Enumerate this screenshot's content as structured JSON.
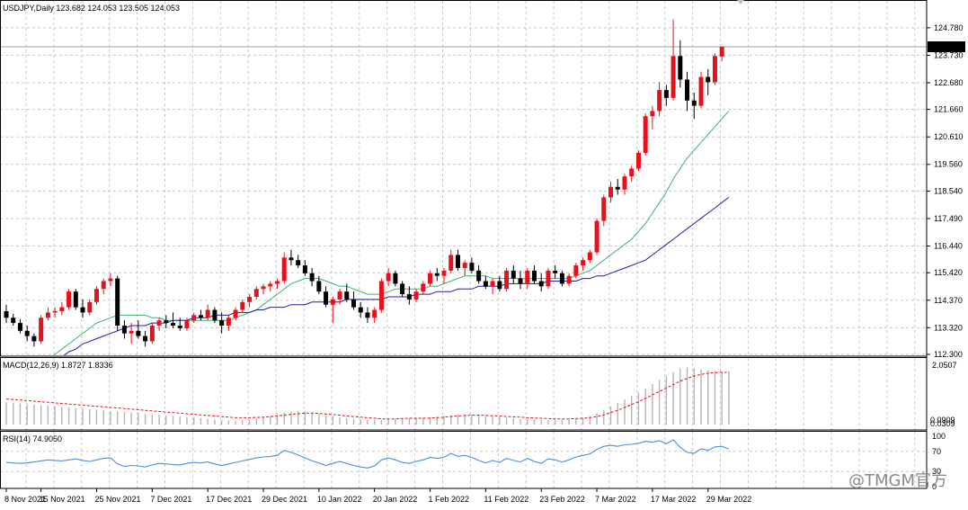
{
  "chart_data": [
    {
      "type": "candlestick",
      "header": "USDJPY,Daily  123.682 124.053 123.505 124.053",
      "price_axis": {
        "min": 112.3,
        "max": 125.05,
        "ticks": [
          "124.780",
          "123.730",
          "122.680",
          "121.660",
          "120.610",
          "119.560",
          "118.540",
          "117.490",
          "116.440",
          "115.420",
          "114.370",
          "113.320",
          "112.300"
        ]
      },
      "current_price": "124.053",
      "x_labels": [
        "8 Nov 2021",
        "15 Nov 2021",
        "25 Nov 2021",
        "7 Dec 2021",
        "17 Dec 2021",
        "29 Dec 2021",
        "10 Jan 2022",
        "20 Jan 2022",
        "1 Feb 2022",
        "11 Feb 2022",
        "23 Feb 2022",
        "7 Mar 2022",
        "17 Mar 2022",
        "29 Mar 2022"
      ],
      "x_label_index": [
        0,
        5,
        13,
        21,
        29,
        37,
        45,
        53,
        61,
        69,
        77,
        85,
        93,
        101
      ],
      "candles": [
        [
          113.95,
          114.2,
          113.5,
          113.7
        ],
        [
          113.7,
          113.85,
          113.4,
          113.5
        ],
        [
          113.5,
          113.65,
          113.1,
          113.2
        ],
        [
          113.2,
          113.4,
          112.8,
          113.0
        ],
        [
          113.0,
          113.1,
          112.6,
          112.8
        ],
        [
          112.8,
          113.8,
          112.7,
          113.7
        ],
        [
          113.7,
          114.1,
          113.6,
          113.9
        ],
        [
          113.9,
          114.1,
          113.7,
          113.95
        ],
        [
          113.95,
          114.3,
          113.8,
          114.1
        ],
        [
          114.1,
          114.8,
          114.0,
          114.7
        ],
        [
          114.7,
          114.8,
          114.0,
          114.1
        ],
        [
          114.1,
          114.4,
          113.7,
          113.9
        ],
        [
          113.9,
          114.4,
          113.8,
          114.3
        ],
        [
          114.3,
          114.9,
          114.2,
          114.8
        ],
        [
          114.8,
          115.2,
          114.6,
          115.1
        ],
        [
          115.1,
          115.4,
          114.9,
          115.2
        ],
        [
          115.2,
          115.3,
          113.2,
          113.4
        ],
        [
          113.4,
          113.6,
          112.9,
          113.1
        ],
        [
          113.1,
          113.5,
          112.7,
          113.2
        ],
        [
          113.2,
          113.6,
          112.9,
          113.0
        ],
        [
          113.0,
          113.2,
          112.6,
          112.8
        ],
        [
          112.8,
          113.5,
          112.7,
          113.4
        ],
        [
          113.4,
          113.7,
          113.2,
          113.6
        ],
        [
          113.6,
          113.8,
          113.3,
          113.5
        ],
        [
          113.5,
          113.9,
          113.3,
          113.4
        ],
        [
          113.4,
          113.7,
          113.2,
          113.3
        ],
        [
          113.3,
          113.7,
          113.2,
          113.6
        ],
        [
          113.6,
          113.9,
          113.5,
          113.8
        ],
        [
          113.8,
          114.0,
          113.6,
          113.7
        ],
        [
          113.7,
          114.2,
          113.6,
          114.0
        ],
        [
          114.0,
          114.1,
          113.5,
          113.6
        ],
        [
          113.6,
          113.9,
          113.1,
          113.4
        ],
        [
          113.4,
          113.8,
          113.2,
          113.7
        ],
        [
          113.7,
          114.1,
          113.6,
          114.0
        ],
        [
          114.0,
          114.4,
          113.9,
          114.3
        ],
        [
          114.3,
          114.6,
          114.1,
          114.5
        ],
        [
          114.5,
          114.9,
          114.4,
          114.8
        ],
        [
          114.8,
          115.0,
          114.6,
          114.9
        ],
        [
          114.9,
          115.1,
          114.7,
          115.0
        ],
        [
          115.0,
          115.2,
          114.8,
          115.1
        ],
        [
          115.1,
          116.2,
          115.0,
          116.0
        ],
        [
          116.0,
          116.3,
          115.7,
          115.9
        ],
        [
          115.9,
          116.1,
          115.6,
          115.7
        ],
        [
          115.7,
          115.9,
          115.3,
          115.4
        ],
        [
          115.4,
          115.6,
          114.9,
          115.1
        ],
        [
          115.1,
          115.3,
          114.6,
          114.7
        ],
        [
          114.7,
          114.9,
          114.1,
          114.2
        ],
        [
          114.2,
          114.5,
          113.5,
          114.4
        ],
        [
          114.4,
          114.8,
          114.2,
          114.7
        ],
        [
          114.7,
          115.0,
          114.3,
          114.4
        ],
        [
          114.4,
          114.7,
          114.0,
          114.1
        ],
        [
          114.1,
          114.3,
          113.7,
          113.9
        ],
        [
          113.9,
          114.1,
          113.5,
          113.7
        ],
        [
          113.7,
          114.1,
          113.5,
          114.0
        ],
        [
          114.0,
          115.2,
          113.9,
          115.1
        ],
        [
          115.1,
          115.6,
          114.9,
          115.4
        ],
        [
          115.4,
          115.5,
          114.9,
          115.0
        ],
        [
          115.0,
          115.1,
          114.5,
          114.6
        ],
        [
          114.6,
          114.9,
          114.2,
          114.4
        ],
        [
          114.4,
          114.8,
          114.3,
          114.7
        ],
        [
          114.7,
          115.1,
          114.6,
          115.0
        ],
        [
          115.0,
          115.5,
          114.9,
          115.4
        ],
        [
          115.4,
          115.6,
          115.1,
          115.3
        ],
        [
          115.3,
          115.6,
          115.0,
          115.5
        ],
        [
          115.5,
          116.3,
          115.4,
          116.1
        ],
        [
          116.1,
          116.3,
          115.5,
          115.6
        ],
        [
          115.6,
          115.9,
          115.3,
          115.8
        ],
        [
          115.8,
          116.0,
          115.4,
          115.5
        ],
        [
          115.5,
          115.7,
          115.0,
          115.1
        ],
        [
          115.1,
          115.3,
          114.8,
          114.9
        ],
        [
          114.9,
          115.2,
          114.6,
          115.1
        ],
        [
          115.1,
          115.3,
          114.7,
          114.8
        ],
        [
          114.8,
          115.6,
          114.7,
          115.5
        ],
        [
          115.5,
          115.7,
          115.0,
          115.2
        ],
        [
          115.2,
          115.5,
          114.8,
          115.0
        ],
        [
          115.0,
          115.6,
          114.8,
          115.5
        ],
        [
          115.5,
          115.7,
          115.0,
          115.1
        ],
        [
          115.1,
          115.4,
          114.7,
          114.9
        ],
        [
          114.9,
          115.6,
          114.8,
          115.5
        ],
        [
          115.5,
          115.7,
          115.2,
          115.4
        ],
        [
          115.4,
          115.5,
          114.9,
          115.0
        ],
        [
          115.0,
          115.4,
          114.9,
          115.3
        ],
        [
          115.3,
          115.8,
          115.2,
          115.7
        ],
        [
          115.7,
          116.0,
          115.5,
          115.9
        ],
        [
          115.9,
          116.3,
          115.8,
          116.2
        ],
        [
          116.2,
          117.5,
          116.1,
          117.4
        ],
        [
          117.4,
          118.4,
          117.2,
          118.3
        ],
        [
          118.3,
          118.9,
          118.1,
          118.7
        ],
        [
          118.7,
          119.0,
          118.4,
          118.6
        ],
        [
          118.6,
          119.2,
          118.4,
          119.1
        ],
        [
          119.1,
          119.5,
          118.9,
          119.4
        ],
        [
          119.4,
          120.1,
          119.3,
          120.0
        ],
        [
          120.0,
          121.5,
          119.9,
          121.4
        ],
        [
          121.4,
          121.8,
          120.9,
          121.6
        ],
        [
          121.6,
          122.7,
          121.4,
          122.4
        ],
        [
          122.4,
          122.6,
          121.8,
          122.1
        ],
        [
          122.1,
          125.1,
          122.0,
          123.7
        ],
        [
          123.7,
          124.3,
          122.5,
          122.8
        ],
        [
          122.8,
          123.1,
          121.6,
          122.0
        ],
        [
          122.0,
          122.3,
          121.3,
          121.8
        ],
        [
          121.8,
          123.1,
          121.7,
          122.9
        ],
        [
          122.9,
          123.2,
          122.2,
          122.7
        ],
        [
          122.7,
          123.8,
          122.6,
          123.7
        ],
        [
          123.682,
          124.053,
          123.505,
          124.053
        ]
      ],
      "ma_fast_label": "MA (green)",
      "ma_fast": [
        110.9,
        111.1,
        111.3,
        111.5,
        111.7,
        111.9,
        112.1,
        112.3,
        112.5,
        112.7,
        112.9,
        113.1,
        113.3,
        113.5,
        113.6,
        113.7,
        113.8,
        113.8,
        113.8,
        113.8,
        113.8,
        113.7,
        113.7,
        113.6,
        113.6,
        113.6,
        113.6,
        113.6,
        113.6,
        113.6,
        113.6,
        113.6,
        113.6,
        113.7,
        113.8,
        113.9,
        114.0,
        114.2,
        114.4,
        114.6,
        114.8,
        115.0,
        115.1,
        115.2,
        115.2,
        115.2,
        115.1,
        115.0,
        114.9,
        114.9,
        114.8,
        114.7,
        114.6,
        114.6,
        114.6,
        114.7,
        114.8,
        114.8,
        114.8,
        114.8,
        114.8,
        114.9,
        114.9,
        115.0,
        115.1,
        115.2,
        115.3,
        115.3,
        115.3,
        115.3,
        115.2,
        115.2,
        115.2,
        115.2,
        115.2,
        115.2,
        115.2,
        115.2,
        115.2,
        115.2,
        115.2,
        115.2,
        115.3,
        115.4,
        115.5,
        115.7,
        115.9,
        116.1,
        116.3,
        116.5,
        116.7,
        117.0,
        117.3,
        117.7,
        118.1,
        118.5,
        119.0,
        119.4,
        119.8,
        120.1,
        120.4,
        120.7,
        121.0,
        121.3,
        121.6
      ],
      "ma_slow_label": "MA (blue)",
      "ma_slow": [
        110.6,
        110.8,
        111.0,
        111.2,
        111.4,
        111.6,
        111.8,
        112.0,
        112.2,
        112.4,
        112.5,
        112.7,
        112.8,
        112.9,
        113.0,
        113.1,
        113.2,
        113.3,
        113.4,
        113.4,
        113.4,
        113.5,
        113.5,
        113.5,
        113.6,
        113.6,
        113.6,
        113.7,
        113.7,
        113.7,
        113.8,
        113.8,
        113.8,
        113.9,
        113.9,
        113.9,
        114.0,
        114.0,
        114.1,
        114.1,
        114.1,
        114.2,
        114.2,
        114.2,
        114.3,
        114.3,
        114.3,
        114.3,
        114.3,
        114.4,
        114.4,
        114.4,
        114.4,
        114.4,
        114.4,
        114.5,
        114.5,
        114.5,
        114.5,
        114.6,
        114.6,
        114.6,
        114.7,
        114.7,
        114.7,
        114.8,
        114.8,
        114.8,
        114.9,
        114.9,
        114.9,
        114.9,
        115.0,
        115.0,
        115.0,
        115.0,
        115.0,
        115.0,
        115.1,
        115.1,
        115.1,
        115.1,
        115.1,
        115.2,
        115.2,
        115.3,
        115.3,
        115.4,
        115.5,
        115.6,
        115.7,
        115.8,
        115.9,
        116.1,
        116.3,
        116.5,
        116.7,
        116.9,
        117.1,
        117.3,
        117.5,
        117.7,
        117.9,
        118.1,
        118.3
      ]
    },
    {
      "type": "macd",
      "label": "MACD(12,26,9) 1.8727 1.8336",
      "axis": {
        "min": 0.0,
        "max": 2.0507,
        "ticks": [
          "2.0507",
          "0.0309"
        ],
        "extra_label": "0.0909"
      },
      "histogram": [
        0.78,
        0.76,
        0.74,
        0.72,
        0.7,
        0.68,
        0.66,
        0.64,
        0.62,
        0.6,
        0.58,
        0.56,
        0.54,
        0.52,
        0.5,
        0.48,
        0.46,
        0.44,
        0.42,
        0.4,
        0.38,
        0.36,
        0.34,
        0.32,
        0.3,
        0.28,
        0.26,
        0.24,
        0.22,
        0.2,
        0.18,
        0.16,
        0.14,
        0.14,
        0.16,
        0.18,
        0.22,
        0.26,
        0.3,
        0.36,
        0.42,
        0.46,
        0.48,
        0.46,
        0.42,
        0.38,
        0.34,
        0.3,
        0.26,
        0.22,
        0.2,
        0.18,
        0.16,
        0.16,
        0.16,
        0.18,
        0.2,
        0.22,
        0.22,
        0.22,
        0.24,
        0.26,
        0.28,
        0.3,
        0.34,
        0.36,
        0.36,
        0.34,
        0.32,
        0.3,
        0.28,
        0.26,
        0.24,
        0.22,
        0.2,
        0.2,
        0.18,
        0.16,
        0.16,
        0.16,
        0.18,
        0.18,
        0.2,
        0.24,
        0.3,
        0.4,
        0.52,
        0.64,
        0.76,
        0.88,
        1.0,
        1.12,
        1.26,
        1.42,
        1.56,
        1.7,
        1.84,
        1.96,
        2.0,
        1.98,
        1.94,
        1.9,
        1.88,
        1.87,
        1.87
      ],
      "signal": [
        0.9,
        0.88,
        0.86,
        0.84,
        0.82,
        0.8,
        0.78,
        0.76,
        0.74,
        0.72,
        0.7,
        0.68,
        0.66,
        0.64,
        0.62,
        0.6,
        0.58,
        0.56,
        0.54,
        0.52,
        0.5,
        0.48,
        0.46,
        0.44,
        0.42,
        0.4,
        0.38,
        0.36,
        0.34,
        0.32,
        0.3,
        0.28,
        0.26,
        0.24,
        0.24,
        0.24,
        0.25,
        0.26,
        0.28,
        0.3,
        0.33,
        0.36,
        0.38,
        0.4,
        0.4,
        0.39,
        0.37,
        0.35,
        0.33,
        0.3,
        0.28,
        0.26,
        0.24,
        0.22,
        0.2,
        0.2,
        0.2,
        0.21,
        0.22,
        0.22,
        0.22,
        0.23,
        0.24,
        0.26,
        0.28,
        0.3,
        0.32,
        0.33,
        0.33,
        0.32,
        0.31,
        0.3,
        0.28,
        0.27,
        0.26,
        0.24,
        0.23,
        0.22,
        0.21,
        0.2,
        0.2,
        0.2,
        0.21,
        0.22,
        0.24,
        0.28,
        0.34,
        0.42,
        0.5,
        0.6,
        0.7,
        0.8,
        0.92,
        1.04,
        1.16,
        1.28,
        1.4,
        1.52,
        1.62,
        1.7,
        1.76,
        1.8,
        1.82,
        1.83,
        1.8336
      ]
    },
    {
      "type": "rsi",
      "label": "RSI(14) 74.9050",
      "axis": {
        "min": 0,
        "max": 100,
        "ticks": [
          "100",
          "70",
          "30",
          "0"
        ]
      },
      "values": [
        48,
        47,
        46,
        47,
        49,
        51,
        53,
        52,
        51,
        53,
        55,
        52,
        50,
        53,
        56,
        57,
        45,
        40,
        42,
        41,
        39,
        43,
        46,
        45,
        44,
        43,
        46,
        48,
        47,
        49,
        45,
        42,
        45,
        48,
        51,
        54,
        57,
        59,
        60,
        62,
        72,
        68,
        63,
        57,
        51,
        47,
        42,
        46,
        50,
        46,
        42,
        39,
        37,
        41,
        53,
        57,
        53,
        48,
        46,
        50,
        53,
        58,
        56,
        58,
        66,
        60,
        62,
        58,
        52,
        47,
        52,
        48,
        56,
        52,
        49,
        56,
        50,
        46,
        55,
        53,
        49,
        53,
        59,
        62,
        65,
        74,
        80,
        82,
        80,
        83,
        84,
        86,
        90,
        88,
        91,
        85,
        93,
        78,
        68,
        66,
        75,
        72,
        79,
        80,
        74.905
      ]
    }
  ],
  "watermark": "@TMGM官方"
}
